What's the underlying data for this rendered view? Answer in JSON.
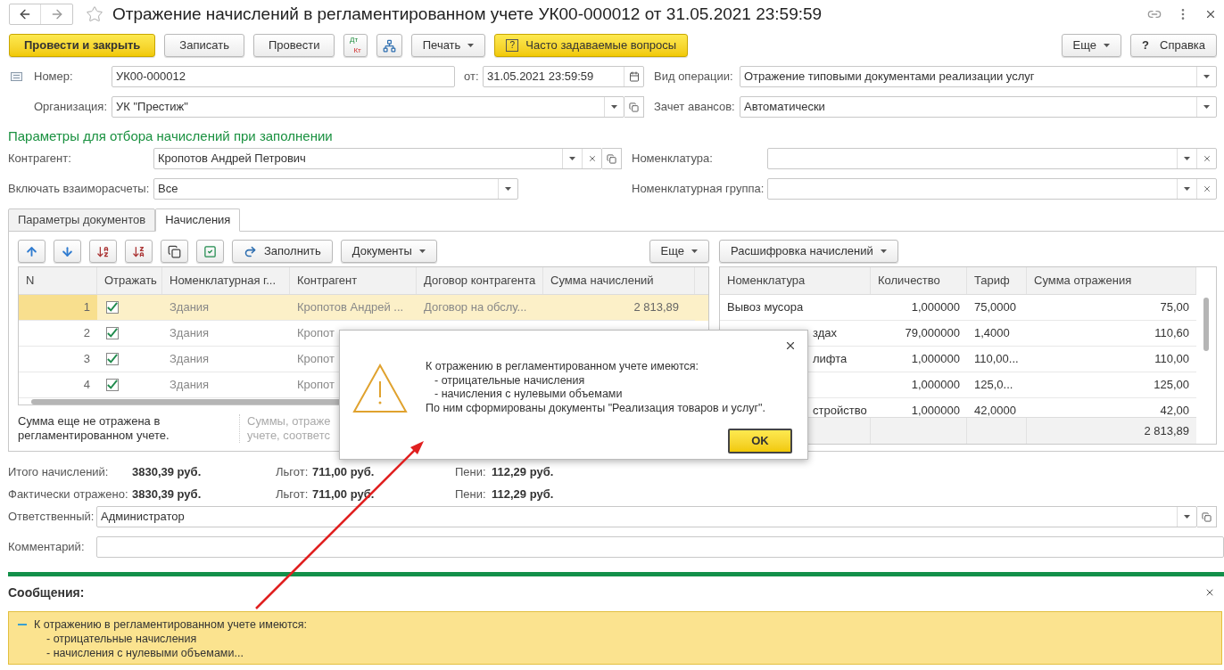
{
  "window": {
    "title": "Отражение начислений в регламентированном учете УК00-000012 от 31.05.2021 23:59:59",
    "favorite": false
  },
  "toolbar": [
    {
      "kind": "primary",
      "label": "Провести и закрыть"
    },
    {
      "kind": "button",
      "label": "Записать"
    },
    {
      "kind": "button",
      "label": "Провести"
    },
    {
      "kind": "dtkt",
      "top": "Дт",
      "bottom": "Кт"
    },
    {
      "kind": "structure"
    },
    {
      "kind": "menu",
      "label": "Печать"
    },
    {
      "kind": "faq",
      "mark": "?",
      "label": "Часто задаваемые вопросы"
    }
  ],
  "toolbar_right": [
    {
      "kind": "menu",
      "label": "Еще"
    },
    {
      "kind": "help",
      "mark": "?",
      "label": "Справка"
    }
  ],
  "header": {
    "number": {
      "label": "Номер:",
      "value": "УК00-000012"
    },
    "date": {
      "label": "от:",
      "value": "31.05.2021 23:59:59"
    },
    "operation": {
      "label": "Вид операции:",
      "value": "Отражение типовыми документами реализации услуг"
    },
    "organization": {
      "label": "Организация:",
      "value": "УК \"Престиж\""
    },
    "advances": {
      "label": "Зачет авансов:",
      "value": "Автоматически"
    }
  },
  "filter": {
    "title": "Параметры для отбора начислений при заполнении",
    "counterparty": {
      "label": "Контрагент:",
      "value": "Кропотов Андрей Петрович"
    },
    "mutual": {
      "label": "Включать взаиморасчеты:",
      "value": "Все"
    },
    "nomenclature": {
      "label": "Номенклатура:"
    },
    "nomenclature_group": {
      "label": "Номенклатурная группа:"
    }
  },
  "tabs": [
    {
      "label": "Параметры документов",
      "selected": false
    },
    {
      "label": "Начисления",
      "selected": true
    }
  ],
  "accruals": {
    "fill": "Заполнить",
    "documents": "Документы",
    "more": "Еще",
    "columns": [
      "N",
      "Отражать",
      "Номенклатурная г...",
      "Контрагент",
      "Договор контрагента",
      "Сумма начислений"
    ],
    "rows": [
      {
        "n": "1",
        "reflect": true,
        "group": "Здания",
        "counterparty": "Кропотов Андрей ...",
        "contract": "Договор на обслу...",
        "sum": "2 813,89",
        "selected": true
      },
      {
        "n": "2",
        "reflect": true,
        "group": "Здания",
        "counterparty": "Кропот",
        "selected": false
      },
      {
        "n": "3",
        "reflect": true,
        "group": "Здания",
        "counterparty": "Кропот",
        "selected": false
      },
      {
        "n": "4",
        "reflect": true,
        "group": "Здания",
        "counterparty": "Кропот",
        "selected": false
      }
    ],
    "note_left": "Сумма еще не отражена в регламентированном учете.",
    "note_right": [
      "Суммы, отраже",
      "учете, соответс"
    ]
  },
  "breakdown": {
    "menu": "Расшифровка начислений",
    "columns": [
      "Номенклатура",
      "Количество",
      "Тариф",
      "Сумма отражения"
    ],
    "rows": [
      {
        "name": "Вывоз мусора",
        "qty": "1,000000",
        "rate": "75,0000",
        "sum": "75,00"
      },
      {
        "name": "здах",
        "qty": "79,000000",
        "rate": "1,4000",
        "sum": "110,60"
      },
      {
        "name": "лифта",
        "qty": "1,000000",
        "rate": "110,00...",
        "sum": "110,00"
      },
      {
        "qty": "1,000000",
        "rate": "125,0...",
        "sum": "125,00"
      },
      {
        "name": "стройство",
        "qty": "1,000000",
        "rate": "42,0000",
        "sum": "42,00"
      }
    ],
    "total": "2 813,89"
  },
  "totals": [
    {
      "label": "Итого начислений:",
      "value": "3830,39 руб.",
      "benefits_label": "Льгот:",
      "benefits": "711,00 руб.",
      "penalty_label": "Пени:",
      "penalty": "112,29 руб."
    },
    {
      "label": "Фактически отражено:",
      "value": "3830,39 руб.",
      "benefits_label": "Льгот:",
      "benefits": "711,00 руб.",
      "penalty_label": "Пени:",
      "penalty": "112,29 руб."
    }
  ],
  "responsible": {
    "label": "Ответственный:",
    "value": "Администратор"
  },
  "comment": {
    "label": "Комментарий:"
  },
  "messages": {
    "title": "Сообщения:",
    "items": [
      {
        "lines": [
          {
            "kind": "text",
            "text": "К отражению в регламентированном учете имеются:"
          },
          {
            "kind": "bullet",
            "text": "- отрицательные начисления"
          },
          {
            "kind": "bullet",
            "text": "- начисления с нулевыми объемами..."
          }
        ]
      }
    ]
  },
  "dialog": {
    "lines": [
      {
        "kind": "text",
        "text": "К отражению в регламентированном учете имеются:"
      },
      {
        "kind": "bullet",
        "text": "- отрицательные начисления"
      },
      {
        "kind": "bullet",
        "text": "- начисления с нулевыми объемами"
      },
      {
        "kind": "text",
        "text": "По ним сформированы документы \"Реализация товаров и услуг\"."
      }
    ],
    "button": "OK"
  }
}
